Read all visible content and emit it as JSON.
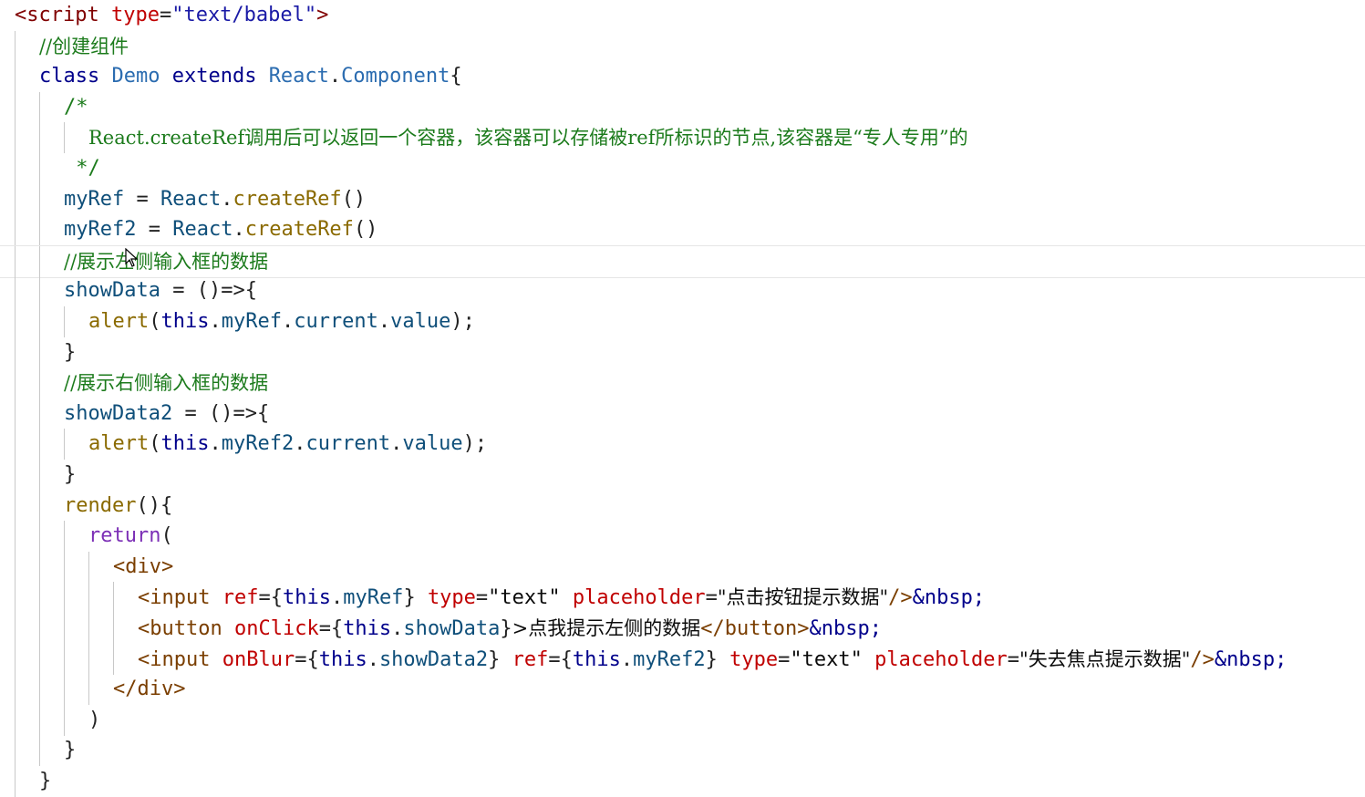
{
  "colors": {
    "tag": "#800000",
    "attr": "#c00000",
    "string": "#1a1aa6",
    "comment": "#1c7b1c",
    "keyword": "#00008b",
    "classname": "#2b6cb0",
    "ident": "#0f4f7a",
    "method": "#8a6a00",
    "value": "#0b0b0b",
    "jsxtag": "#7a3e00",
    "return_kw": "#7c2fb6",
    "plain": "#222222"
  },
  "lines": [
    {
      "indent": 0,
      "tokens": [
        [
          "<script ",
          "tag"
        ],
        [
          "type",
          "attr"
        ],
        [
          "=",
          "plain"
        ],
        [
          "\"text/babel\"",
          "string"
        ],
        [
          ">",
          "tag"
        ]
      ]
    },
    {
      "indent": 1,
      "tokens": [
        [
          "//创建组件",
          "comment"
        ]
      ]
    },
    {
      "indent": 1,
      "tokens": [
        [
          "class ",
          "keyword"
        ],
        [
          "Demo ",
          "classname"
        ],
        [
          "extends ",
          "keyword"
        ],
        [
          "React",
          "classname"
        ],
        [
          ".",
          "plain"
        ],
        [
          "Component",
          "classname"
        ],
        [
          "{",
          "plain"
        ]
      ]
    },
    {
      "indent": 2,
      "tokens": [
        [
          "/*",
          "comment"
        ]
      ]
    },
    {
      "indent": 3,
      "tokens": [
        [
          "React.createRef调用后可以返回一个容器，该容器可以存储被ref所标识的节点,该容器是“专人专用”的",
          "comment"
        ]
      ]
    },
    {
      "indent": 2,
      "tokens": [
        [
          " */",
          "comment"
        ]
      ]
    },
    {
      "indent": 2,
      "tokens": [
        [
          "myRef",
          "ident"
        ],
        [
          " = ",
          "plain"
        ],
        [
          "React",
          "ident"
        ],
        [
          ".",
          "plain"
        ],
        [
          "createRef",
          "method"
        ],
        [
          "()",
          "plain"
        ]
      ]
    },
    {
      "indent": 2,
      "tokens": [
        [
          "myRef2",
          "ident"
        ],
        [
          " = ",
          "plain"
        ],
        [
          "React",
          "ident"
        ],
        [
          ".",
          "plain"
        ],
        [
          "createRef",
          "method"
        ],
        [
          "()",
          "plain"
        ]
      ]
    },
    {
      "indent": 2,
      "current": true,
      "tokens": [
        [
          "//展示左侧输入框的数据",
          "comment"
        ]
      ]
    },
    {
      "indent": 2,
      "tokens": [
        [
          "showData",
          "ident"
        ],
        [
          " = ",
          "plain"
        ],
        [
          "()=>{",
          "plain"
        ]
      ]
    },
    {
      "indent": 3,
      "tokens": [
        [
          "alert",
          "method"
        ],
        [
          "(",
          "plain"
        ],
        [
          "this",
          "keyword"
        ],
        [
          ".",
          "plain"
        ],
        [
          "myRef",
          "ident"
        ],
        [
          ".",
          "plain"
        ],
        [
          "current",
          "ident"
        ],
        [
          ".",
          "plain"
        ],
        [
          "value",
          "ident"
        ],
        [
          ");",
          "plain"
        ]
      ]
    },
    {
      "indent": 2,
      "tokens": [
        [
          "}",
          "plain"
        ]
      ]
    },
    {
      "indent": 2,
      "tokens": [
        [
          "//展示右侧输入框的数据",
          "comment"
        ]
      ]
    },
    {
      "indent": 2,
      "tokens": [
        [
          "showData2",
          "ident"
        ],
        [
          " = ",
          "plain"
        ],
        [
          "()=>{",
          "plain"
        ]
      ]
    },
    {
      "indent": 3,
      "tokens": [
        [
          "alert",
          "method"
        ],
        [
          "(",
          "plain"
        ],
        [
          "this",
          "keyword"
        ],
        [
          ".",
          "plain"
        ],
        [
          "myRef2",
          "ident"
        ],
        [
          ".",
          "plain"
        ],
        [
          "current",
          "ident"
        ],
        [
          ".",
          "plain"
        ],
        [
          "value",
          "ident"
        ],
        [
          ");",
          "plain"
        ]
      ]
    },
    {
      "indent": 2,
      "tokens": [
        [
          "}",
          "plain"
        ]
      ]
    },
    {
      "indent": 2,
      "tokens": [
        [
          "render",
          "method"
        ],
        [
          "(){",
          "plain"
        ]
      ]
    },
    {
      "indent": 3,
      "tokens": [
        [
          "return",
          "return_kw"
        ],
        [
          "(",
          "plain"
        ]
      ]
    },
    {
      "indent": 4,
      "tokens": [
        [
          "<div>",
          "jsxtag"
        ]
      ]
    },
    {
      "indent": 5,
      "tokens": [
        [
          "<input ",
          "jsxtag"
        ],
        [
          "ref",
          "attr"
        ],
        [
          "={",
          "plain"
        ],
        [
          "this",
          "keyword"
        ],
        [
          ".",
          "plain"
        ],
        [
          "myRef",
          "ident"
        ],
        [
          "} ",
          "plain"
        ],
        [
          "type",
          "attr"
        ],
        [
          "=",
          "plain"
        ],
        [
          "\"text\" ",
          "value"
        ],
        [
          "placeholder",
          "attr"
        ],
        [
          "=",
          "plain"
        ],
        [
          "\"点击按钮提示数据\"",
          "value"
        ],
        [
          "/>",
          "jsxtag"
        ],
        [
          "&nbsp;",
          "keyword"
        ]
      ]
    },
    {
      "indent": 5,
      "tokens": [
        [
          "<button ",
          "jsxtag"
        ],
        [
          "onClick",
          "attr"
        ],
        [
          "={",
          "plain"
        ],
        [
          "this",
          "keyword"
        ],
        [
          ".",
          "plain"
        ],
        [
          "showData",
          "ident"
        ],
        [
          "}",
          "plain"
        ],
        [
          ">点我提示左侧的数据",
          "value"
        ],
        [
          "</button>",
          "jsxtag"
        ],
        [
          "&nbsp;",
          "keyword"
        ]
      ]
    },
    {
      "indent": 5,
      "tokens": [
        [
          "<input ",
          "jsxtag"
        ],
        [
          "onBlur",
          "attr"
        ],
        [
          "={",
          "plain"
        ],
        [
          "this",
          "keyword"
        ],
        [
          ".",
          "plain"
        ],
        [
          "showData2",
          "ident"
        ],
        [
          "} ",
          "plain"
        ],
        [
          "ref",
          "attr"
        ],
        [
          "={",
          "plain"
        ],
        [
          "this",
          "keyword"
        ],
        [
          ".",
          "plain"
        ],
        [
          "myRef2",
          "ident"
        ],
        [
          "} ",
          "plain"
        ],
        [
          "type",
          "attr"
        ],
        [
          "=",
          "plain"
        ],
        [
          "\"text\" ",
          "value"
        ],
        [
          "placeholder",
          "attr"
        ],
        [
          "=",
          "plain"
        ],
        [
          "\"失去焦点提示数据\"",
          "value"
        ],
        [
          "/>",
          "jsxtag"
        ],
        [
          "&nbsp;",
          "keyword"
        ]
      ]
    },
    {
      "indent": 4,
      "tokens": [
        [
          "</div>",
          "jsxtag"
        ]
      ]
    },
    {
      "indent": 3,
      "tokens": [
        [
          ")",
          "plain"
        ]
      ]
    },
    {
      "indent": 2,
      "tokens": [
        [
          "}",
          "plain"
        ]
      ]
    },
    {
      "indent": 1,
      "tokens": [
        [
          "}",
          "plain"
        ]
      ]
    }
  ]
}
